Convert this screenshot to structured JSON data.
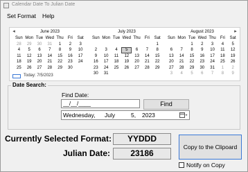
{
  "window": {
    "title": "Calendar Date To Julian Date"
  },
  "menu": {
    "set_format": "Set Format",
    "help": "Help"
  },
  "calendar": {
    "prev_glyph": "◂",
    "next_glyph": "▸",
    "weekdays": [
      "Sun",
      "Mon",
      "Tue",
      "Wed",
      "Thu",
      "Fri",
      "Sat"
    ],
    "months": [
      {
        "title": "June 2023",
        "days": [
          {
            "d": "28",
            "other": true
          },
          {
            "d": "29",
            "other": true
          },
          {
            "d": "30",
            "other": true
          },
          {
            "d": "31",
            "other": true
          },
          {
            "d": "1"
          },
          {
            "d": "2"
          },
          {
            "d": "3"
          },
          {
            "d": "4"
          },
          {
            "d": "5"
          },
          {
            "d": "6"
          },
          {
            "d": "7"
          },
          {
            "d": "8"
          },
          {
            "d": "9"
          },
          {
            "d": "10"
          },
          {
            "d": "11"
          },
          {
            "d": "12"
          },
          {
            "d": "13"
          },
          {
            "d": "14"
          },
          {
            "d": "15"
          },
          {
            "d": "16"
          },
          {
            "d": "17"
          },
          {
            "d": "18"
          },
          {
            "d": "19"
          },
          {
            "d": "20"
          },
          {
            "d": "21"
          },
          {
            "d": "22"
          },
          {
            "d": "23"
          },
          {
            "d": "24"
          },
          {
            "d": "25"
          },
          {
            "d": "26"
          },
          {
            "d": "27"
          },
          {
            "d": "28"
          },
          {
            "d": "29"
          },
          {
            "d": "30"
          }
        ]
      },
      {
        "title": "July 2023",
        "days": [
          {
            "d": ""
          },
          {
            "d": ""
          },
          {
            "d": ""
          },
          {
            "d": ""
          },
          {
            "d": ""
          },
          {
            "d": ""
          },
          {
            "d": "1"
          },
          {
            "d": "2"
          },
          {
            "d": "3"
          },
          {
            "d": "4"
          },
          {
            "d": "5",
            "selected": true
          },
          {
            "d": "6"
          },
          {
            "d": "7"
          },
          {
            "d": "8"
          },
          {
            "d": "9"
          },
          {
            "d": "10"
          },
          {
            "d": "11"
          },
          {
            "d": "12"
          },
          {
            "d": "13"
          },
          {
            "d": "14"
          },
          {
            "d": "15"
          },
          {
            "d": "16"
          },
          {
            "d": "17"
          },
          {
            "d": "18"
          },
          {
            "d": "19"
          },
          {
            "d": "20"
          },
          {
            "d": "21"
          },
          {
            "d": "22"
          },
          {
            "d": "23"
          },
          {
            "d": "24"
          },
          {
            "d": "25"
          },
          {
            "d": "26"
          },
          {
            "d": "27"
          },
          {
            "d": "28"
          },
          {
            "d": "29"
          },
          {
            "d": "30"
          },
          {
            "d": "31"
          }
        ]
      },
      {
        "title": "August 2023",
        "days": [
          {
            "d": ""
          },
          {
            "d": ""
          },
          {
            "d": "1"
          },
          {
            "d": "2"
          },
          {
            "d": "3"
          },
          {
            "d": "4"
          },
          {
            "d": "5"
          },
          {
            "d": "6"
          },
          {
            "d": "7"
          },
          {
            "d": "8"
          },
          {
            "d": "9"
          },
          {
            "d": "10"
          },
          {
            "d": "11"
          },
          {
            "d": "12"
          },
          {
            "d": "13"
          },
          {
            "d": "14"
          },
          {
            "d": "15"
          },
          {
            "d": "16"
          },
          {
            "d": "17"
          },
          {
            "d": "18"
          },
          {
            "d": "19"
          },
          {
            "d": "20"
          },
          {
            "d": "21"
          },
          {
            "d": "22"
          },
          {
            "d": "23"
          },
          {
            "d": "24"
          },
          {
            "d": "25"
          },
          {
            "d": "26"
          },
          {
            "d": "27"
          },
          {
            "d": "28"
          },
          {
            "d": "29"
          },
          {
            "d": "30"
          },
          {
            "d": "31"
          },
          {
            "d": "1",
            "other": true
          },
          {
            "d": "2",
            "other": true
          },
          {
            "d": "3",
            "other": true
          },
          {
            "d": "4",
            "other": true
          },
          {
            "d": "5",
            "other": true
          },
          {
            "d": "6",
            "other": true
          },
          {
            "d": "7",
            "other": true
          },
          {
            "d": "8",
            "other": true
          },
          {
            "d": "9",
            "other": true
          }
        ]
      }
    ],
    "today_label": "Today: 7/5/2023"
  },
  "date_search": {
    "group_label": "Date Search:",
    "find_label": "Find Date:",
    "find_value": "__/__/____",
    "find_button": "Find",
    "picker": {
      "weekday": "Wednesday,",
      "month": "July",
      "day": "5,",
      "year": "2023"
    },
    "picker_icon": "calendar-dropdown-icon"
  },
  "results": {
    "format_label": "Currently Selected Format:",
    "format_value": "YYDDD",
    "julian_label": "Julian Date:",
    "julian_value": "23186"
  },
  "actions": {
    "copy_button": "Copy to the Clipoard",
    "notify_label": "Notify on Copy",
    "notify_checked": false
  },
  "colors": {
    "accent": "#3a78d6",
    "window_bg": "#f0f0f0"
  }
}
